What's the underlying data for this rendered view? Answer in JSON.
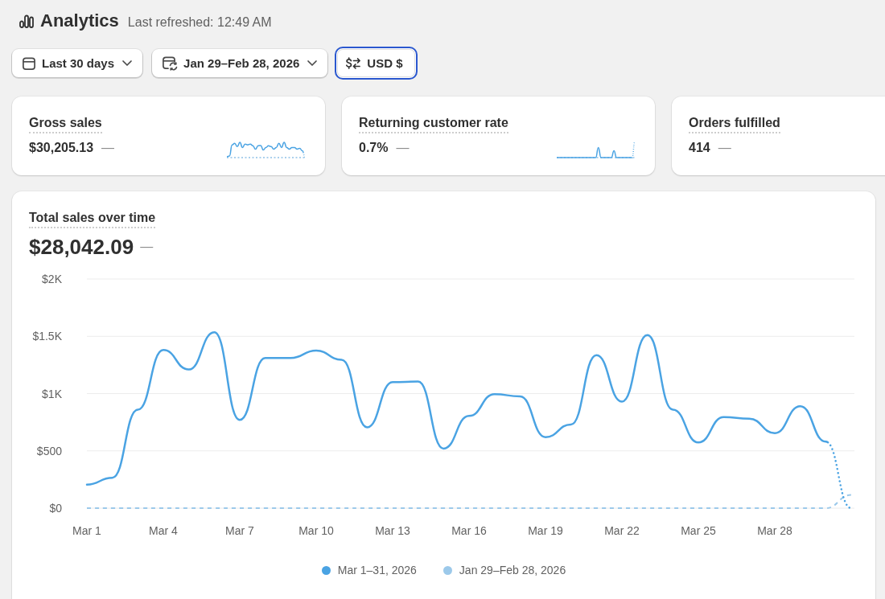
{
  "header": {
    "title": "Analytics",
    "refreshed": "Last refreshed: 12:49 AM"
  },
  "filters": [
    {
      "kind": "date-range",
      "label": "Last 30 days",
      "focused": false
    },
    {
      "kind": "comparison",
      "label": "Jan 29–Feb 28, 2026",
      "focused": false
    },
    {
      "kind": "currency",
      "label": "USD $",
      "focused": true
    }
  ],
  "metrics": [
    {
      "kind": "wave-trend",
      "title": "Gross sales",
      "value": "$30,205.13",
      "change": "—"
    },
    {
      "kind": "spike-trend",
      "title": "Returning customer rate",
      "value": "0.7%",
      "change": "—"
    },
    {
      "kind": "plain",
      "title": "Orders fulfilled",
      "value": "414",
      "change": "—"
    }
  ],
  "sales_chart": {
    "title": "Total sales over time",
    "value": "$28,042.09",
    "change": "—",
    "chart_data": {
      "type": "line",
      "categories": [
        "Mar 1",
        null,
        null,
        "Mar 4",
        null,
        null,
        "Mar 7",
        null,
        null,
        "Mar 10",
        null,
        null,
        "Mar 13",
        null,
        null,
        "Mar 16",
        null,
        null,
        "Mar 19",
        null,
        null,
        "Mar 22",
        null,
        null,
        "Mar 25",
        null,
        null,
        "Mar 28",
        null,
        null,
        null
      ],
      "ylim": [
        0,
        2000
      ],
      "yticks": [
        {
          "value": 0,
          "label": "$0"
        },
        {
          "value": 500,
          "label": "$500"
        },
        {
          "value": 1000,
          "label": "$1K"
        },
        {
          "value": 1500,
          "label": "$1.5K"
        },
        {
          "value": 2000,
          "label": "$2K"
        }
      ],
      "grid": true,
      "series": [
        {
          "name": "Mar 1–31, 2026",
          "color": "#4aa3e3",
          "line_style": "solid-dotted-end",
          "values": [
            205,
            265,
            860,
            1380,
            1210,
            1535,
            770,
            1310,
            1310,
            1375,
            1295,
            705,
            1100,
            1105,
            520,
            805,
            995,
            975,
            620,
            730,
            1335,
            930,
            1510,
            860,
            573,
            795,
            780,
            655,
            890,
            580,
            0
          ]
        },
        {
          "name": "Jan 29–Feb 28, 2026",
          "color": "#9cc9ea",
          "line_style": "dashed",
          "values": [
            0,
            0,
            0,
            0,
            0,
            0,
            0,
            0,
            0,
            0,
            0,
            0,
            0,
            0,
            0,
            0,
            0,
            0,
            0,
            0,
            0,
            0,
            0,
            0,
            0,
            0,
            0,
            0,
            0,
            0,
            115
          ]
        }
      ]
    }
  }
}
